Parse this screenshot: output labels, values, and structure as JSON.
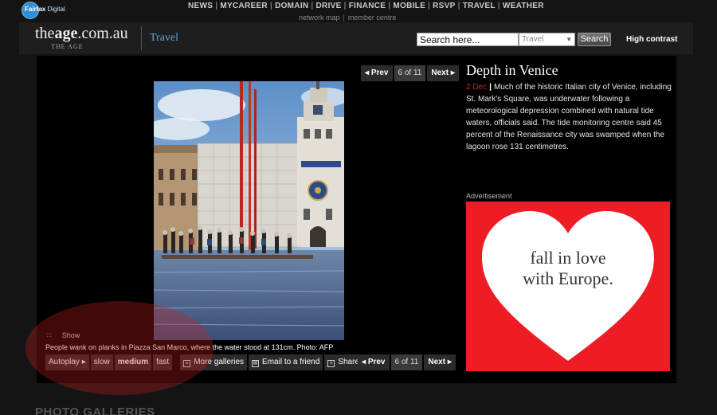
{
  "topbar": {
    "logo": {
      "name": "Fairfax",
      "suffix": "Digital"
    },
    "nav": [
      "NEWS",
      "MYCAREER",
      "DOMAIN",
      "DRIVE",
      "FINANCE",
      "MOBILE",
      "RSVP",
      "TRAVEL",
      "WEATHER"
    ],
    "subnav": [
      "network map",
      "member centre"
    ]
  },
  "header": {
    "brand": {
      "prefix": "the",
      "bold": "age",
      "suffix": ".com.au"
    },
    "brand_sub": "THE AGE",
    "section": "Travel",
    "search": {
      "placeholder": "Search here...",
      "scope": "Travel",
      "button": "Search"
    },
    "high_contrast": "High contrast"
  },
  "gallery": {
    "prev_label": "Prev",
    "next_label": "Next",
    "position": "6 of 11",
    "title": "Depth in Venice",
    "date": "2 Dec",
    "description": "Much of the historic Italian city of Venice, including St. Mark's Square, was underwater following a meteorological depression combined with natural tide waters, officials said. The tide monitoring centre said 45 percent of the Renaissance city was swamped when the lagoon rose 131 centimetres.",
    "show_label": "Show",
    "caption": "People wank on planks in Piazza San Marco, where the water stood at 131cm. Photo: AFP",
    "controls": {
      "autoplay": "Autoplay",
      "slow": "slow",
      "medium": "medium",
      "fast": "fast",
      "more": "More galleries",
      "email": "Email to a friend",
      "share": "Share"
    }
  },
  "ad": {
    "label": "Advertisement",
    "line1": "fall in love",
    "line2": "with Europe."
  },
  "footer": {
    "galleries_heading": "PHOTO GALLERIES"
  },
  "colors": {
    "accent_blue": "#5fa8d8",
    "date_red": "#c8282b",
    "ad_red": "#ee1c25"
  }
}
